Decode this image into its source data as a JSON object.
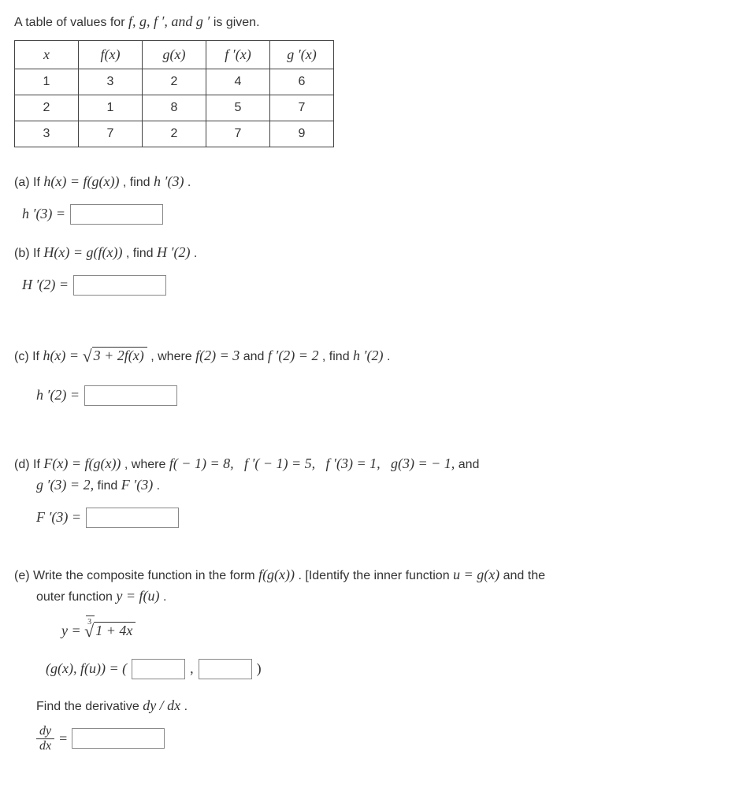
{
  "intro": "A table of values for ",
  "intro_funcs": "f,  g,  f ′,  and g ′",
  "intro_tail": " is given.",
  "table": {
    "headers": [
      "x",
      "f(x)",
      "g(x)",
      "f ′(x)",
      "g ′(x)"
    ],
    "rows": [
      [
        "1",
        "3",
        "2",
        "4",
        "6"
      ],
      [
        "2",
        "1",
        "8",
        "5",
        "7"
      ],
      [
        "3",
        "7",
        "2",
        "7",
        "9"
      ]
    ]
  },
  "a": {
    "label": "(a) If ",
    "expr1": "h(x) = f(g(x))",
    "mid": ", find ",
    "expr2": "h ′(3)",
    "tail": ".",
    "ans_lhs": "h ′(3) ="
  },
  "b": {
    "label": "(b) If ",
    "expr1": "H(x) = g(f(x))",
    "mid": ", find ",
    "expr2": "H ′(2)",
    "tail": ".",
    "ans_lhs": "H ′(2) ="
  },
  "c": {
    "label": "(c) If ",
    "expr_lhs": "h(x) = ",
    "rad": "3 + 2f(x)",
    "mid1": ", where ",
    "cond1": "f(2) = 3",
    "and1": " and ",
    "cond2": "f ′(2) = 2",
    "mid2": ", find ",
    "target": "h ′(2)",
    "tail": ".",
    "ans_lhs": "h ′(2) ="
  },
  "d": {
    "label": "(d) If ",
    "expr1": "F(x) = f(g(x))",
    "mid1": ", where ",
    "c1": "f( − 1) = 8,",
    "c2": "f ′( − 1) = 5,",
    "c3": "f ′(3) = 1,",
    "c4": "g(3) =  − 1,",
    "and": " and",
    "line2a": "g ′(3) = 2,",
    "line2b": " find ",
    "target": "F ′(3)",
    "tail": ".",
    "ans_lhs": "F ′(3) ="
  },
  "e": {
    "label": "(e) Write the composite function in the form ",
    "form": "f(g(x))",
    "mid1": ". [Identify the inner function ",
    "inner": "u = g(x)",
    "mid2": " and the",
    "line2a": "outer function ",
    "outer": "y = f(u)",
    "tail2": ".",
    "eq_lhs": "y = ",
    "rad": "1 + 4x",
    "pair_lhs": "(g(x), f(u)) = (",
    "comma": " , ",
    "close": " )",
    "find": "Find the derivative ",
    "deriv": "dy / dx",
    "tail3": ".",
    "frac_num": "dy",
    "frac_den": "dx",
    "eq": " = "
  }
}
